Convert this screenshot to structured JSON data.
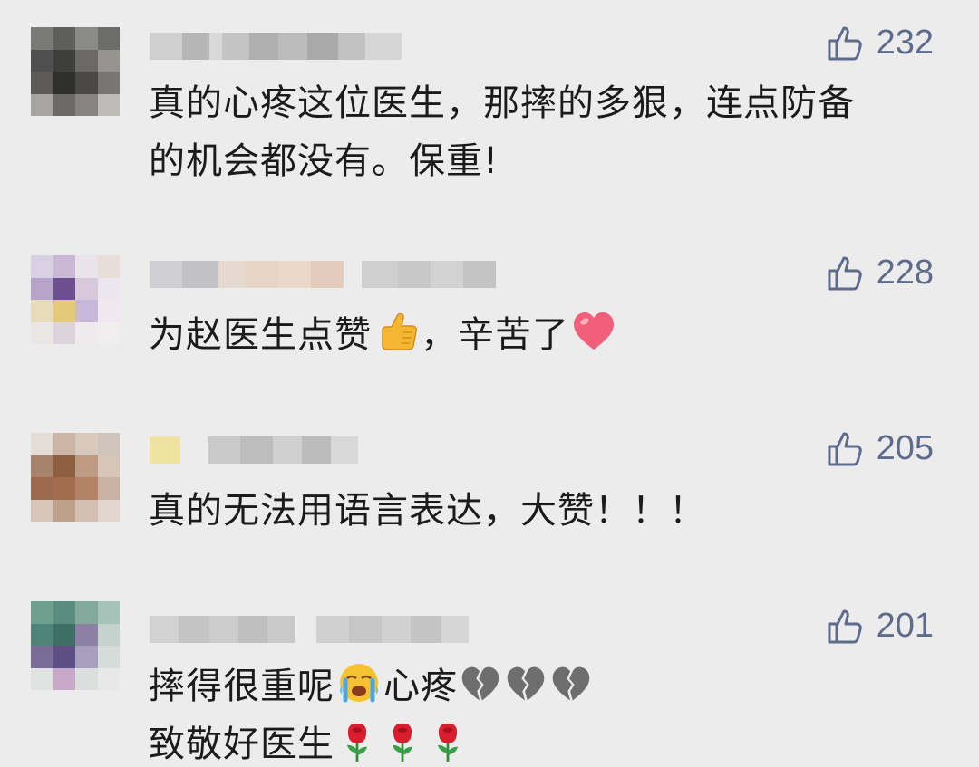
{
  "comments": [
    {
      "likes": "232",
      "line1": "真的心疼这位医生，那摔的多狠，连点防备",
      "line2": "的机会都没有。保重!"
    },
    {
      "likes": "228",
      "part1": "为赵医生点赞",
      "part2": "，辛苦了",
      "emojis": [
        "thumbs-up-icon",
        "red-heart-icon"
      ]
    },
    {
      "likes": "205",
      "line1": "真的无法用语言表达，大赞！！！"
    },
    {
      "likes": "201",
      "part1": "摔得很重呢",
      "part2": "心疼",
      "line2": "致敬好医生",
      "emojis": [
        "loudly-crying-icon",
        "broken-heart-icon",
        "rose-icon"
      ]
    }
  ],
  "colors": {
    "background": "#ececec",
    "like_color": "#5d6b8c",
    "text": "#1b1b1b"
  }
}
